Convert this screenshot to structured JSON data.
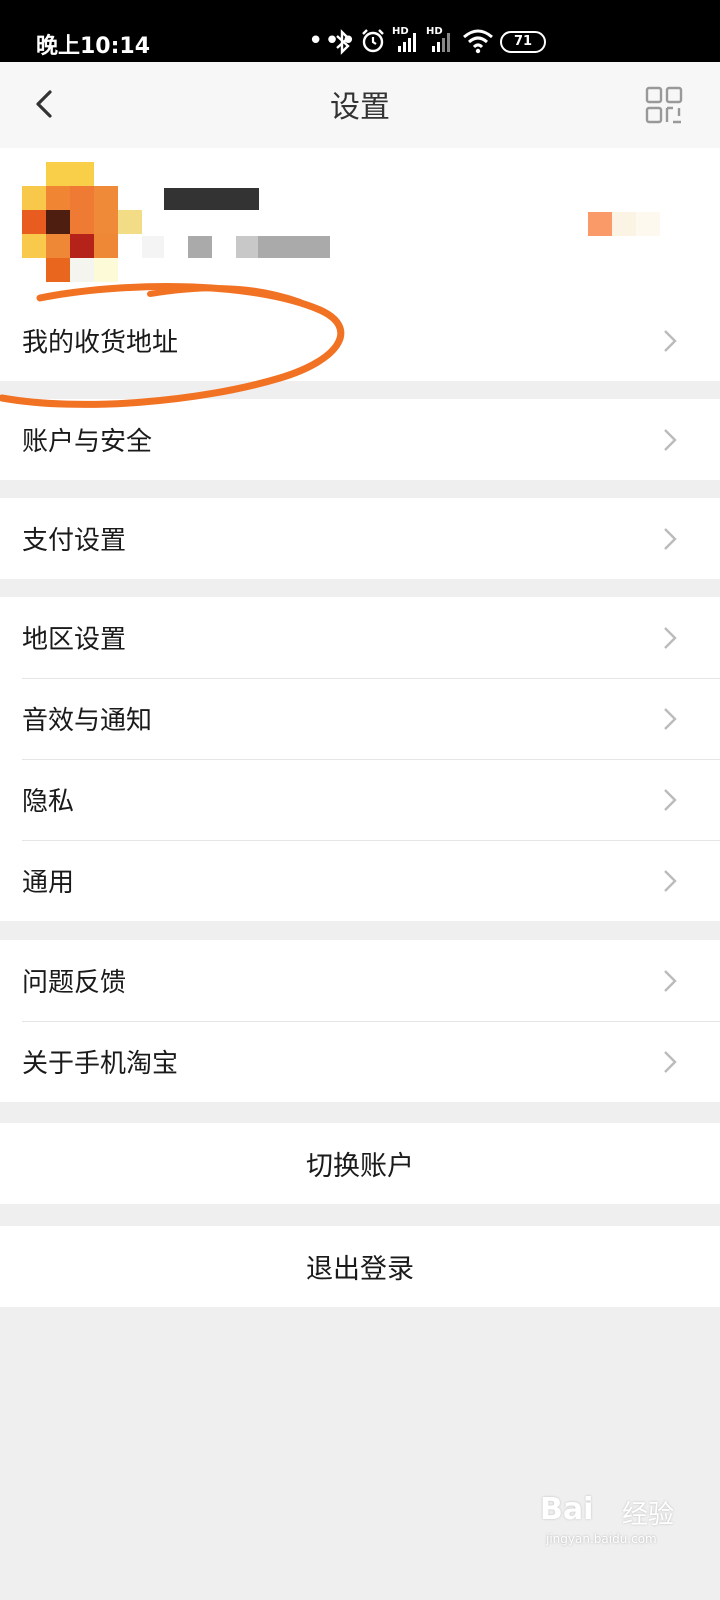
{
  "status_bar": {
    "time": "晚上10:14",
    "battery": "71",
    "hd1": "HD",
    "hd2": "HD"
  },
  "nav": {
    "title": "设置"
  },
  "sections": [
    {
      "items": [
        {
          "label": "我的收货地址"
        }
      ]
    },
    {
      "items": [
        {
          "label": "账户与安全"
        }
      ]
    },
    {
      "items": [
        {
          "label": "支付设置"
        }
      ]
    },
    {
      "items": [
        {
          "label": "地区设置"
        },
        {
          "label": "音效与通知"
        },
        {
          "label": "隐私"
        },
        {
          "label": "通用"
        }
      ]
    },
    {
      "items": [
        {
          "label": "问题反馈"
        },
        {
          "label": "关于手机淘宝"
        }
      ]
    }
  ],
  "actions": {
    "switch_account": "切换账户",
    "logout": "退出登录"
  },
  "watermark": {
    "main": "Bai",
    "cn": "经验",
    "url": "jingyan.baidu.com"
  },
  "colors": {
    "annotation": "#f27224",
    "background": "#efefef"
  }
}
